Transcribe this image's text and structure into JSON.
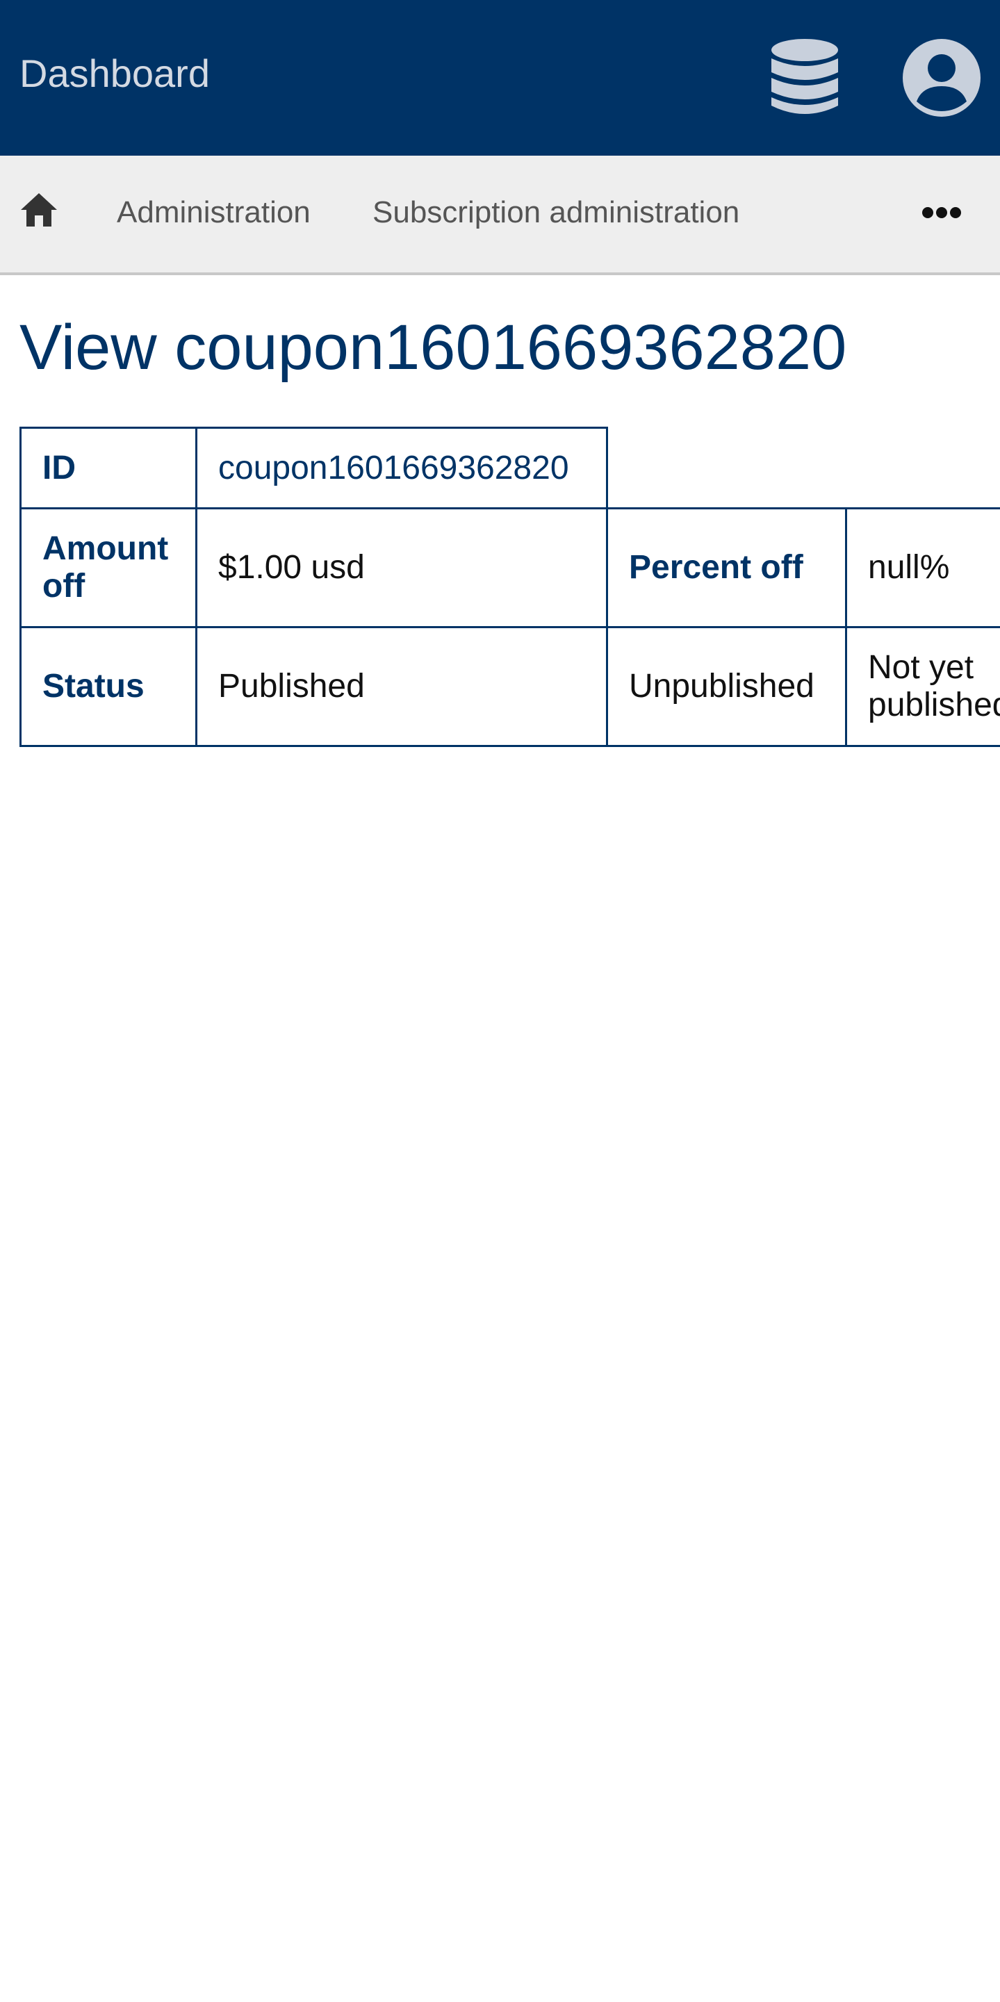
{
  "header": {
    "brand": "Dashboard",
    "database_icon": "database-icon",
    "account_icon": "user-circle-icon",
    "color": "#003366"
  },
  "nav": {
    "home_icon": "home-icon",
    "items": [
      {
        "label": "Administration"
      },
      {
        "label": "Subscription administration"
      }
    ],
    "more_icon": "ellipsis-icon"
  },
  "page": {
    "title": "View coupon1601669362820"
  },
  "details": {
    "id_label": "ID",
    "id_value": "coupon1601669362820",
    "amount_off_label": "Amount off",
    "amount_off_value": "$1.00 usd",
    "percent_off_label": "Percent off",
    "percent_off_value": "null%",
    "status_label": "Status",
    "status_published": "Published",
    "status_unpublished": "Unpublished",
    "status_note": "Not yet published"
  }
}
